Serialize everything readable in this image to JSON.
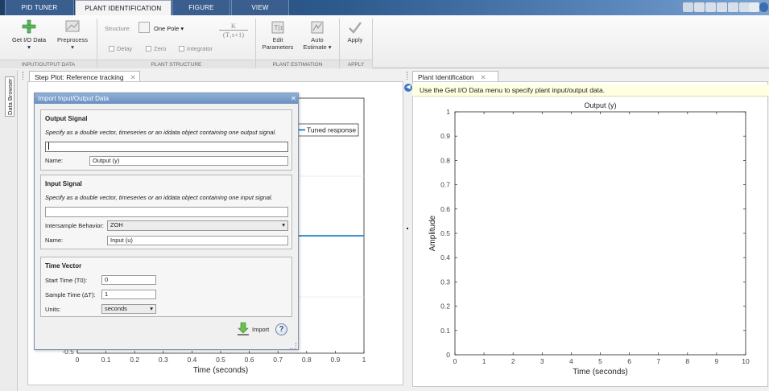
{
  "tabs": [
    {
      "label": "PID TUNER"
    },
    {
      "label": "PLANT IDENTIFICATION"
    },
    {
      "label": "FIGURE"
    },
    {
      "label": "VIEW"
    }
  ],
  "ribbon": {
    "get_io_data": "Get I/O Data",
    "preprocess": "Preprocess",
    "structure_label": "Structure:",
    "structure_value": "One Pole",
    "delay": "Delay",
    "zero": "Zero",
    "integrator": "Integrator",
    "formula_num": "K",
    "formula_den": "(T₁s+1)",
    "edit_parameters_1": "Edit",
    "edit_parameters_2": "Parameters",
    "auto_estimate_1": "Auto",
    "auto_estimate_2": "Estimate",
    "apply": "Apply",
    "sections": [
      "INPUT/OUTPUT DATA",
      "PLANT STRUCTURE",
      "PLANT ESTIMATION",
      "APPLY"
    ]
  },
  "browser": {
    "label": "Data Browser"
  },
  "left_doc": {
    "tab_title": "Step Plot: Reference tracking",
    "legend": "Tuned response",
    "xlabel": "Time (seconds)",
    "xticks": [
      "0",
      "0.1",
      "0.2",
      "0.3",
      "0.4",
      "0.5",
      "0.6",
      "0.7",
      "0.8",
      "0.9",
      "1"
    ],
    "ytick_bottom": "-0.5"
  },
  "dialog": {
    "title": "Import Input/Output Data",
    "output_group": "Output Signal",
    "output_hint": "Specify as a double vector, timeseries or an iddata object containing one output signal.",
    "output_value": "",
    "output_name_label": "Name:",
    "output_name": "Output (y)",
    "input_group": "Input Signal",
    "input_hint": "Specify as a double vector, timeseries or an iddata object containing one input signal.",
    "input_value": "",
    "intersample_label": "Intersample Behavior:",
    "intersample_value": "ZOH",
    "input_name_label": "Name:",
    "input_name": "Input (u)",
    "time_group": "Time Vector",
    "start_time_label": "Start Time (T0):",
    "start_time": "0",
    "sample_time_label": "Sample Time (ΔT):",
    "sample_time": "1",
    "units_label": "Units:",
    "units_value": "seconds",
    "import_button": "Import"
  },
  "right_doc": {
    "tab_title": "Plant Identification",
    "info_message": "Use the Get I/O Data menu to specify plant input/output data."
  },
  "chart_data": {
    "type": "line",
    "title": "Output (y)",
    "xlabel": "Time (seconds)",
    "ylabel": "Amplitude",
    "xlim": [
      0,
      10
    ],
    "ylim": [
      0,
      1
    ],
    "xticks": [
      0,
      1,
      2,
      3,
      4,
      5,
      6,
      7,
      8,
      9,
      10
    ],
    "yticks": [
      0,
      0.1,
      0.2,
      0.3,
      0.4,
      0.5,
      0.6,
      0.7,
      0.8,
      0.9,
      1
    ],
    "series": [],
    "grid": false
  },
  "colors": {
    "accent": "#0072bd",
    "tab_bar": "#2e5a8e",
    "info_bg": "#ffffe1"
  }
}
